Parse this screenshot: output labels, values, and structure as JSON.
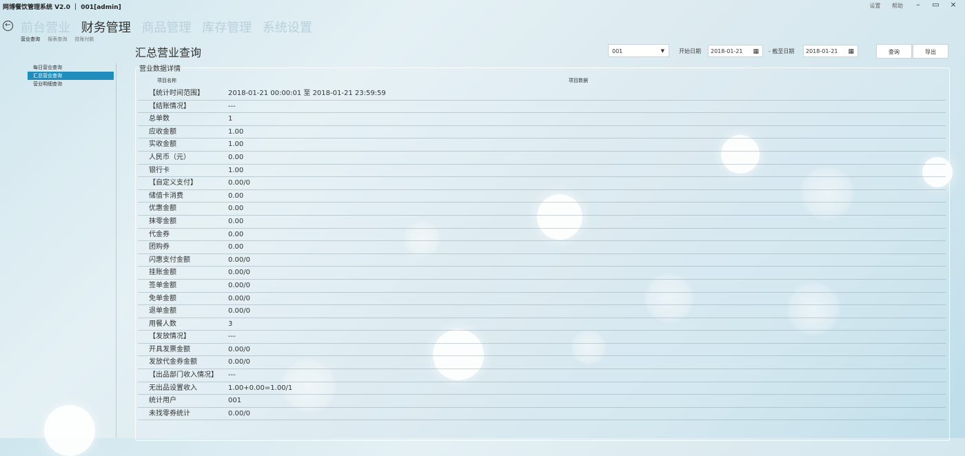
{
  "app": {
    "title": "网博餐饮管理系统 V2.0 ｜ 001[admin]",
    "top_links": [
      "设置",
      "帮助"
    ],
    "window_controls": [
      "–",
      "▭",
      "×"
    ]
  },
  "nav": {
    "back_icon": "back-arrow-icon",
    "main": [
      "前台营业",
      "财务管理",
      "商品管理",
      "库存管理",
      "系统设置"
    ],
    "active_main": 1,
    "sub": [
      "营业查询",
      "报表查询",
      "挂账付款"
    ],
    "active_sub": 0
  },
  "sidebar": {
    "items": [
      "每日营业查询",
      "汇总营业查询",
      "营业明细查询"
    ],
    "active": 1
  },
  "page": {
    "title": "汇总营业查询"
  },
  "filters": {
    "store_value": "001",
    "start_label": "开始日期",
    "start_date": "2018-01-21",
    "end_label": "- 截至日期",
    "end_date": "2018-01-21",
    "query_button": "查询",
    "export_button": "导出"
  },
  "panel": {
    "legend": "营业数据详情",
    "col_name": "项目名称",
    "col_value": "项目数据",
    "rows": [
      {
        "k": "【统计时间范围】",
        "v": "2018-01-21 00:00:01 至 2018-01-21 23:59:59"
      },
      {
        "k": "【结账情况】",
        "v": "---"
      },
      {
        "k": "总单数",
        "v": "1"
      },
      {
        "k": "应收金额",
        "v": "1.00"
      },
      {
        "k": "实收金额",
        "v": "1.00"
      },
      {
        "k": "人民币（元）",
        "v": "0.00"
      },
      {
        "k": "银行卡",
        "v": "1.00"
      },
      {
        "k": "【自定义支付】",
        "v": "0.00/0"
      },
      {
        "k": "储值卡消费",
        "v": "0.00"
      },
      {
        "k": "优惠金额",
        "v": "0.00"
      },
      {
        "k": "抹零金额",
        "v": "0.00"
      },
      {
        "k": "代金券",
        "v": "0.00"
      },
      {
        "k": "团购券",
        "v": "0.00"
      },
      {
        "k": "闪惠支付金额",
        "v": "0.00/0"
      },
      {
        "k": "挂账金额",
        "v": "0.00/0"
      },
      {
        "k": "签单金额",
        "v": "0.00/0"
      },
      {
        "k": "免单金额",
        "v": "0.00/0"
      },
      {
        "k": "退单金额",
        "v": "0.00/0"
      },
      {
        "k": "用餐人数",
        "v": "3"
      },
      {
        "k": "【发放情况】",
        "v": "---"
      },
      {
        "k": "开具发票金额",
        "v": "0.00/0"
      },
      {
        "k": "发放代金券金额",
        "v": "0.00/0"
      },
      {
        "k": "【出品部门收入情况】",
        "v": "---"
      },
      {
        "k": "无出品设置收入",
        "v": "1.00+0.00=1.00/1"
      },
      {
        "k": "统计用户",
        "v": "001"
      },
      {
        "k": "未找零券统计",
        "v": "0.00/0"
      }
    ]
  }
}
